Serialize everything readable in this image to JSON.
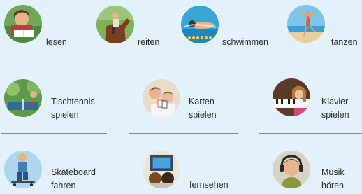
{
  "activities": [
    {
      "id": "lesen",
      "lines": [
        "lesen"
      ],
      "icon": "reading-child-photo"
    },
    {
      "id": "reiten",
      "lines": [
        "reiten"
      ],
      "icon": "horse-riding-photo"
    },
    {
      "id": "schwimmen",
      "lines": [
        "schwimmen"
      ],
      "icon": "swimming-photo"
    },
    {
      "id": "tanzen",
      "lines": [
        "tanzen"
      ],
      "icon": "beach-dancing-photo"
    },
    {
      "id": "tischtennis",
      "lines": [
        "Tischtennis",
        "spielen"
      ],
      "icon": "table-tennis-photo"
    },
    {
      "id": "karten",
      "lines": [
        "Karten",
        "spielen"
      ],
      "icon": "card-playing-photo"
    },
    {
      "id": "klavier",
      "lines": [
        "Klavier",
        "spielen"
      ],
      "icon": "piano-photo"
    },
    {
      "id": "skateboard",
      "lines": [
        "Skateboard",
        "fahren"
      ],
      "icon": "skateboard-photo"
    },
    {
      "id": "fernsehen",
      "lines": [
        "fernsehen"
      ],
      "icon": "watching-tv-photo"
    },
    {
      "id": "musik",
      "lines": [
        "Musik",
        "hören"
      ],
      "icon": "headphones-music-photo"
    }
  ]
}
